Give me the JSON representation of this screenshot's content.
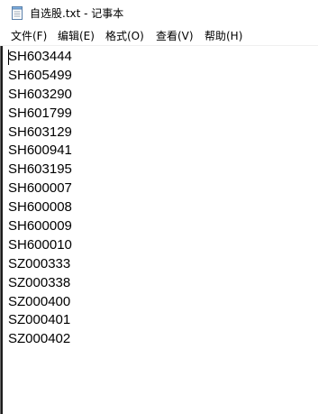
{
  "window": {
    "title": "自选股.txt - 记事本",
    "icon": "notepad-icon"
  },
  "menu": {
    "file": "文件(F)",
    "edit": "编辑(E)",
    "format": "格式(O)",
    "view": "查看(V)",
    "help": "帮助(H)"
  },
  "document": {
    "lines": [
      "SH603444",
      "SH605499",
      "SH603290",
      "SH601799",
      "SH603129",
      "SH600941",
      "SH603195",
      "SH600007",
      "SH600008",
      "SH600009",
      "SH600010",
      "SZ000333",
      "SZ000338",
      "SZ000400",
      "SZ000401",
      "SZ000402"
    ]
  }
}
